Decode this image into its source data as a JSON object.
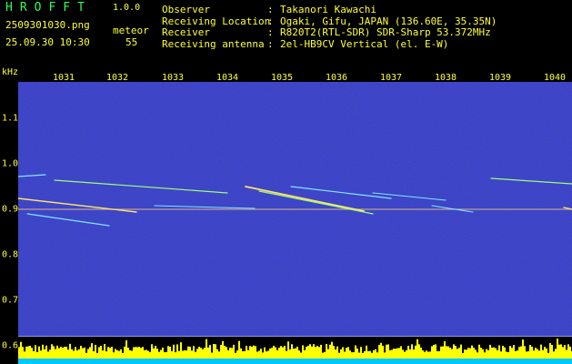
{
  "header": {
    "logo": "HROFFT",
    "version": "1.0.0",
    "filename": "2509301030.png",
    "datetime": "25.09.30 10:30",
    "meteor_label": "meteor",
    "meteor_count": "55"
  },
  "info": [
    {
      "key": "Observer",
      "sep": ":",
      "value": "Takanori Kawachi"
    },
    {
      "key": "Receiving Location",
      "sep": ":",
      "value": "Ogaki, Gifu, JAPAN (136.60E, 35.35N)"
    },
    {
      "key": "Receiver",
      "sep": ":",
      "value": "R820T2(RTL-SDR) SDR-Sharp 53.372MHz"
    },
    {
      "key": "Receiving antenna",
      "sep": ":",
      "value": "2el-HB9CV Vertical (el. E-W)"
    }
  ],
  "axis": {
    "y_unit": "kHz",
    "x_ticks": [
      "1031",
      "1032",
      "1033",
      "1034",
      "1035",
      "1036",
      "1037",
      "1038",
      "1039",
      "1040"
    ],
    "y_ticks": [
      "1.1",
      "1.0",
      "0.9",
      "0.8",
      "0.7",
      "0.6"
    ]
  },
  "colors": {
    "background": "#000000",
    "text": "#ffff33",
    "logo": "#2cff55",
    "noise": "#1a1a9a",
    "level_bars": "#ffff00",
    "level_base": "#00c8ff"
  }
}
